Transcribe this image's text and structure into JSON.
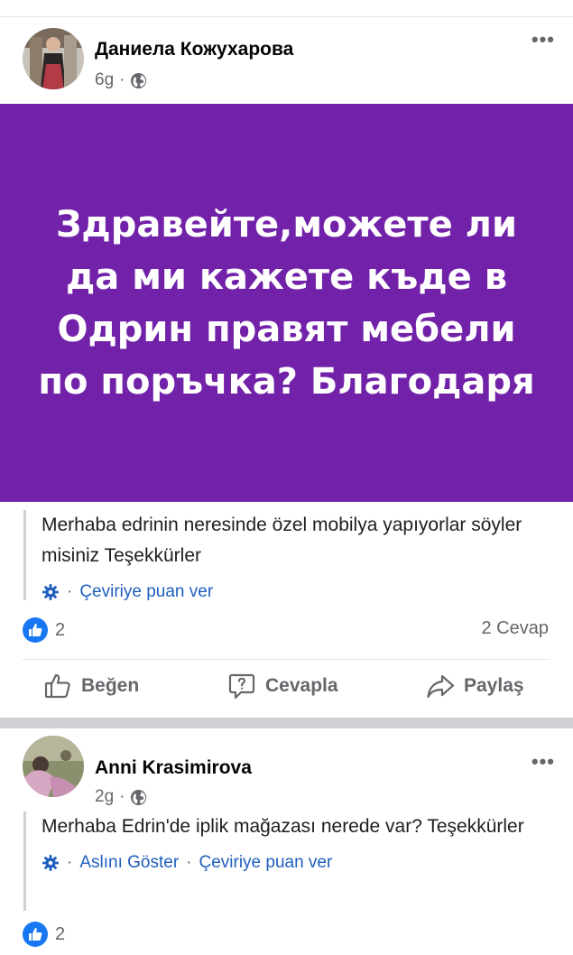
{
  "posts": [
    {
      "author": "Даниела Кожухарова",
      "time": "6g",
      "banner_text": "Здравейте,можете ли да ми кажете къде в Одрин правят мебели по поръчка? Благодаря",
      "translation": "Merhaba edrinin neresinde özel mobilya yapıyorlar söyler misiniz Teşekkürler",
      "rate_translation": "Çeviriye puan ver",
      "reaction_count": "2",
      "replies": "2 Cevap",
      "actions": {
        "like": "Beğen",
        "reply": "Cevapla",
        "share": "Paylaş"
      }
    },
    {
      "author": "Anni Krasimirova",
      "time": "2g",
      "translation": "Merhaba Edrin'de iplik mağazası nerede var? Teşekkürler",
      "show_original": "Aslını Göster",
      "rate_translation": "Çeviriye puan ver",
      "reaction_count": "2"
    }
  ],
  "icons": {
    "more": "more-horizontal-icon",
    "privacy": "globe-icon",
    "translation": "gear-icon",
    "reaction": "like-reaction-icon"
  },
  "colors": {
    "banner": "#7222a9",
    "link": "#1f5fbf",
    "like_blue": "#1877f2",
    "secondary_text": "#65676b"
  }
}
